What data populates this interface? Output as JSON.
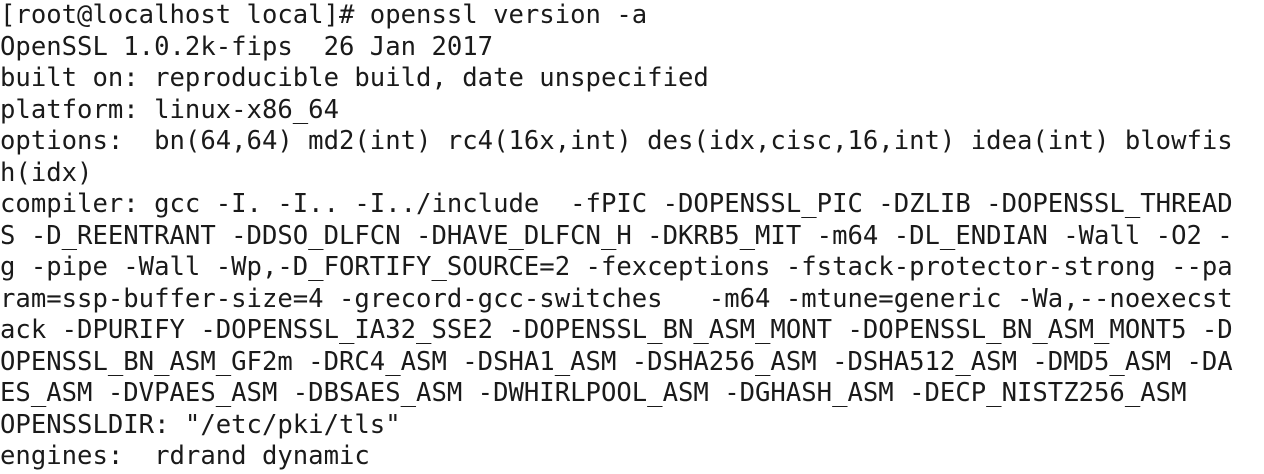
{
  "terminal": {
    "lines": [
      "[root@localhost local]# openssl version -a",
      "OpenSSL 1.0.2k-fips  26 Jan 2017",
      "built on: reproducible build, date unspecified",
      "platform: linux-x86_64",
      "options:  bn(64,64) md2(int) rc4(16x,int) des(idx,cisc,16,int) idea(int) blowfis",
      "h(idx)",
      "compiler: gcc -I. -I.. -I../include  -fPIC -DOPENSSL_PIC -DZLIB -DOPENSSL_THREAD",
      "S -D_REENTRANT -DDSO_DLFCN -DHAVE_DLFCN_H -DKRB5_MIT -m64 -DL_ENDIAN -Wall -O2 -",
      "g -pipe -Wall -Wp,-D_FORTIFY_SOURCE=2 -fexceptions -fstack-protector-strong --pa",
      "ram=ssp-buffer-size=4 -grecord-gcc-switches   -m64 -mtune=generic -Wa,--noexecst",
      "ack -DPURIFY -DOPENSSL_IA32_SSE2 -DOPENSSL_BN_ASM_MONT -DOPENSSL_BN_ASM_MONT5 -D",
      "OPENSSL_BN_ASM_GF2m -DRC4_ASM -DSHA1_ASM -DSHA256_ASM -DSHA512_ASM -DMD5_ASM -DA",
      "ES_ASM -DVPAES_ASM -DBSAES_ASM -DWHIRLPOOL_ASM -DGHASH_ASM -DECP_NISTZ256_ASM",
      "OPENSSLDIR: \"/etc/pki/tls\"",
      "engines:  rdrand dynamic"
    ]
  }
}
